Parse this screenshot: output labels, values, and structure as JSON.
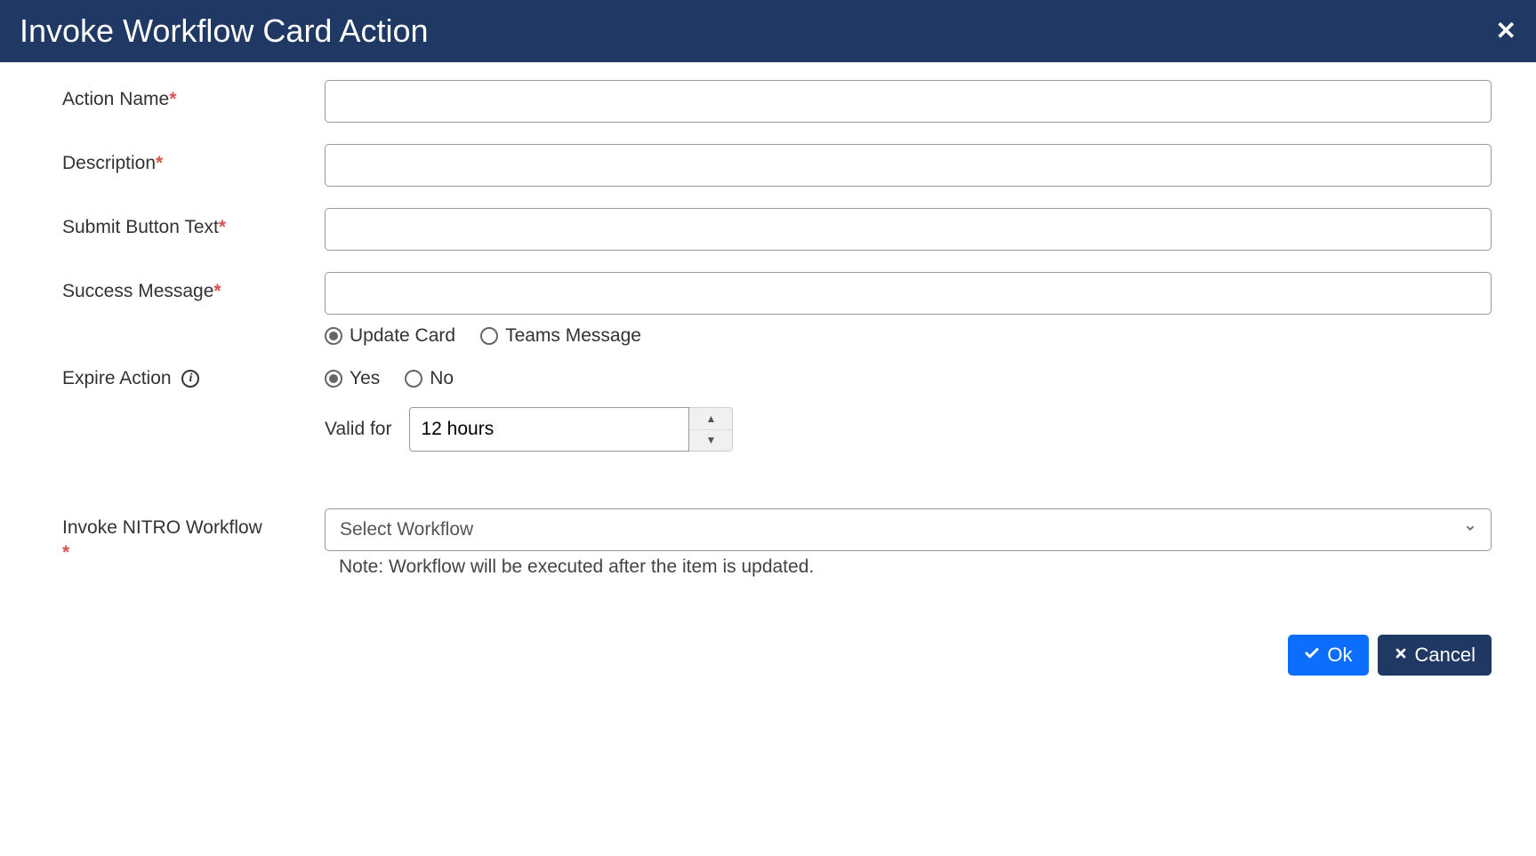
{
  "header": {
    "title": "Invoke Workflow Card Action"
  },
  "form": {
    "actionName": {
      "label": "Action Name",
      "value": ""
    },
    "description": {
      "label": "Description",
      "value": ""
    },
    "submitButtonText": {
      "label": "Submit Button Text",
      "value": ""
    },
    "successMessage": {
      "label": "Success Message",
      "value": "",
      "radios": {
        "updateCard": "Update Card",
        "teamsMessage": "Teams Message"
      }
    },
    "expireAction": {
      "label": "Expire Action",
      "radios": {
        "yes": "Yes",
        "no": "No"
      },
      "validFor": {
        "label": "Valid for",
        "value": "12 hours"
      }
    },
    "invokeWorkflow": {
      "label": "Invoke NITRO Workflow",
      "placeholder": "Select Workflow",
      "note": "Note: Workflow will be executed after the item is updated."
    }
  },
  "footer": {
    "ok": "Ok",
    "cancel": "Cancel"
  },
  "required": "*"
}
